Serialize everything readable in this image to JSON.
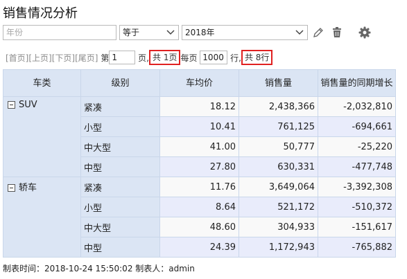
{
  "page_title": "销售情况分析",
  "filter": {
    "field_placeholder": "年份",
    "operator": "等于",
    "value": "2018年"
  },
  "pager": {
    "first": "[首页]",
    "prev": "[上页]",
    "next": "[下页]",
    "last": "[尾页]",
    "page_prefix": "第",
    "current_page": "1",
    "page_suffix": "页,",
    "total_pages": "共 1页",
    "per_page_prefix": "每页",
    "per_page": "1000",
    "per_page_suffix": "行,",
    "total_rows": "共 8行"
  },
  "table": {
    "headers": [
      "车类",
      "级别",
      "车均价",
      "销售量",
      "销售量的同期增长"
    ],
    "groups": [
      {
        "category": "SUV",
        "rows": [
          {
            "level": "紧凑",
            "avg_price": "18.12",
            "sales": "2,438,366",
            "growth": "-2,032,810"
          },
          {
            "level": "小型",
            "avg_price": "10.41",
            "sales": "761,125",
            "growth": "-694,661"
          },
          {
            "level": "中大型",
            "avg_price": "41.00",
            "sales": "50,777",
            "growth": "-25,220"
          },
          {
            "level": "中型",
            "avg_price": "27.80",
            "sales": "630,331",
            "growth": "-477,748"
          }
        ]
      },
      {
        "category": "轿车",
        "rows": [
          {
            "level": "紧凑",
            "avg_price": "11.76",
            "sales": "3,649,064",
            "growth": "-3,392,308"
          },
          {
            "level": "小型",
            "avg_price": "8.64",
            "sales": "521,172",
            "growth": "-510,372"
          },
          {
            "level": "中大型",
            "avg_price": "48.60",
            "sales": "304,933",
            "growth": "-151,617"
          },
          {
            "level": "中型",
            "avg_price": "24.39",
            "sales": "1,172,943",
            "growth": "-765,882"
          }
        ]
      }
    ]
  },
  "footer": "制表时间：2018-10-24 15:50:02   制表人：admin",
  "icons": {
    "edit": "pencil-icon",
    "delete": "trash-icon",
    "settings": "gear-icon"
  }
}
